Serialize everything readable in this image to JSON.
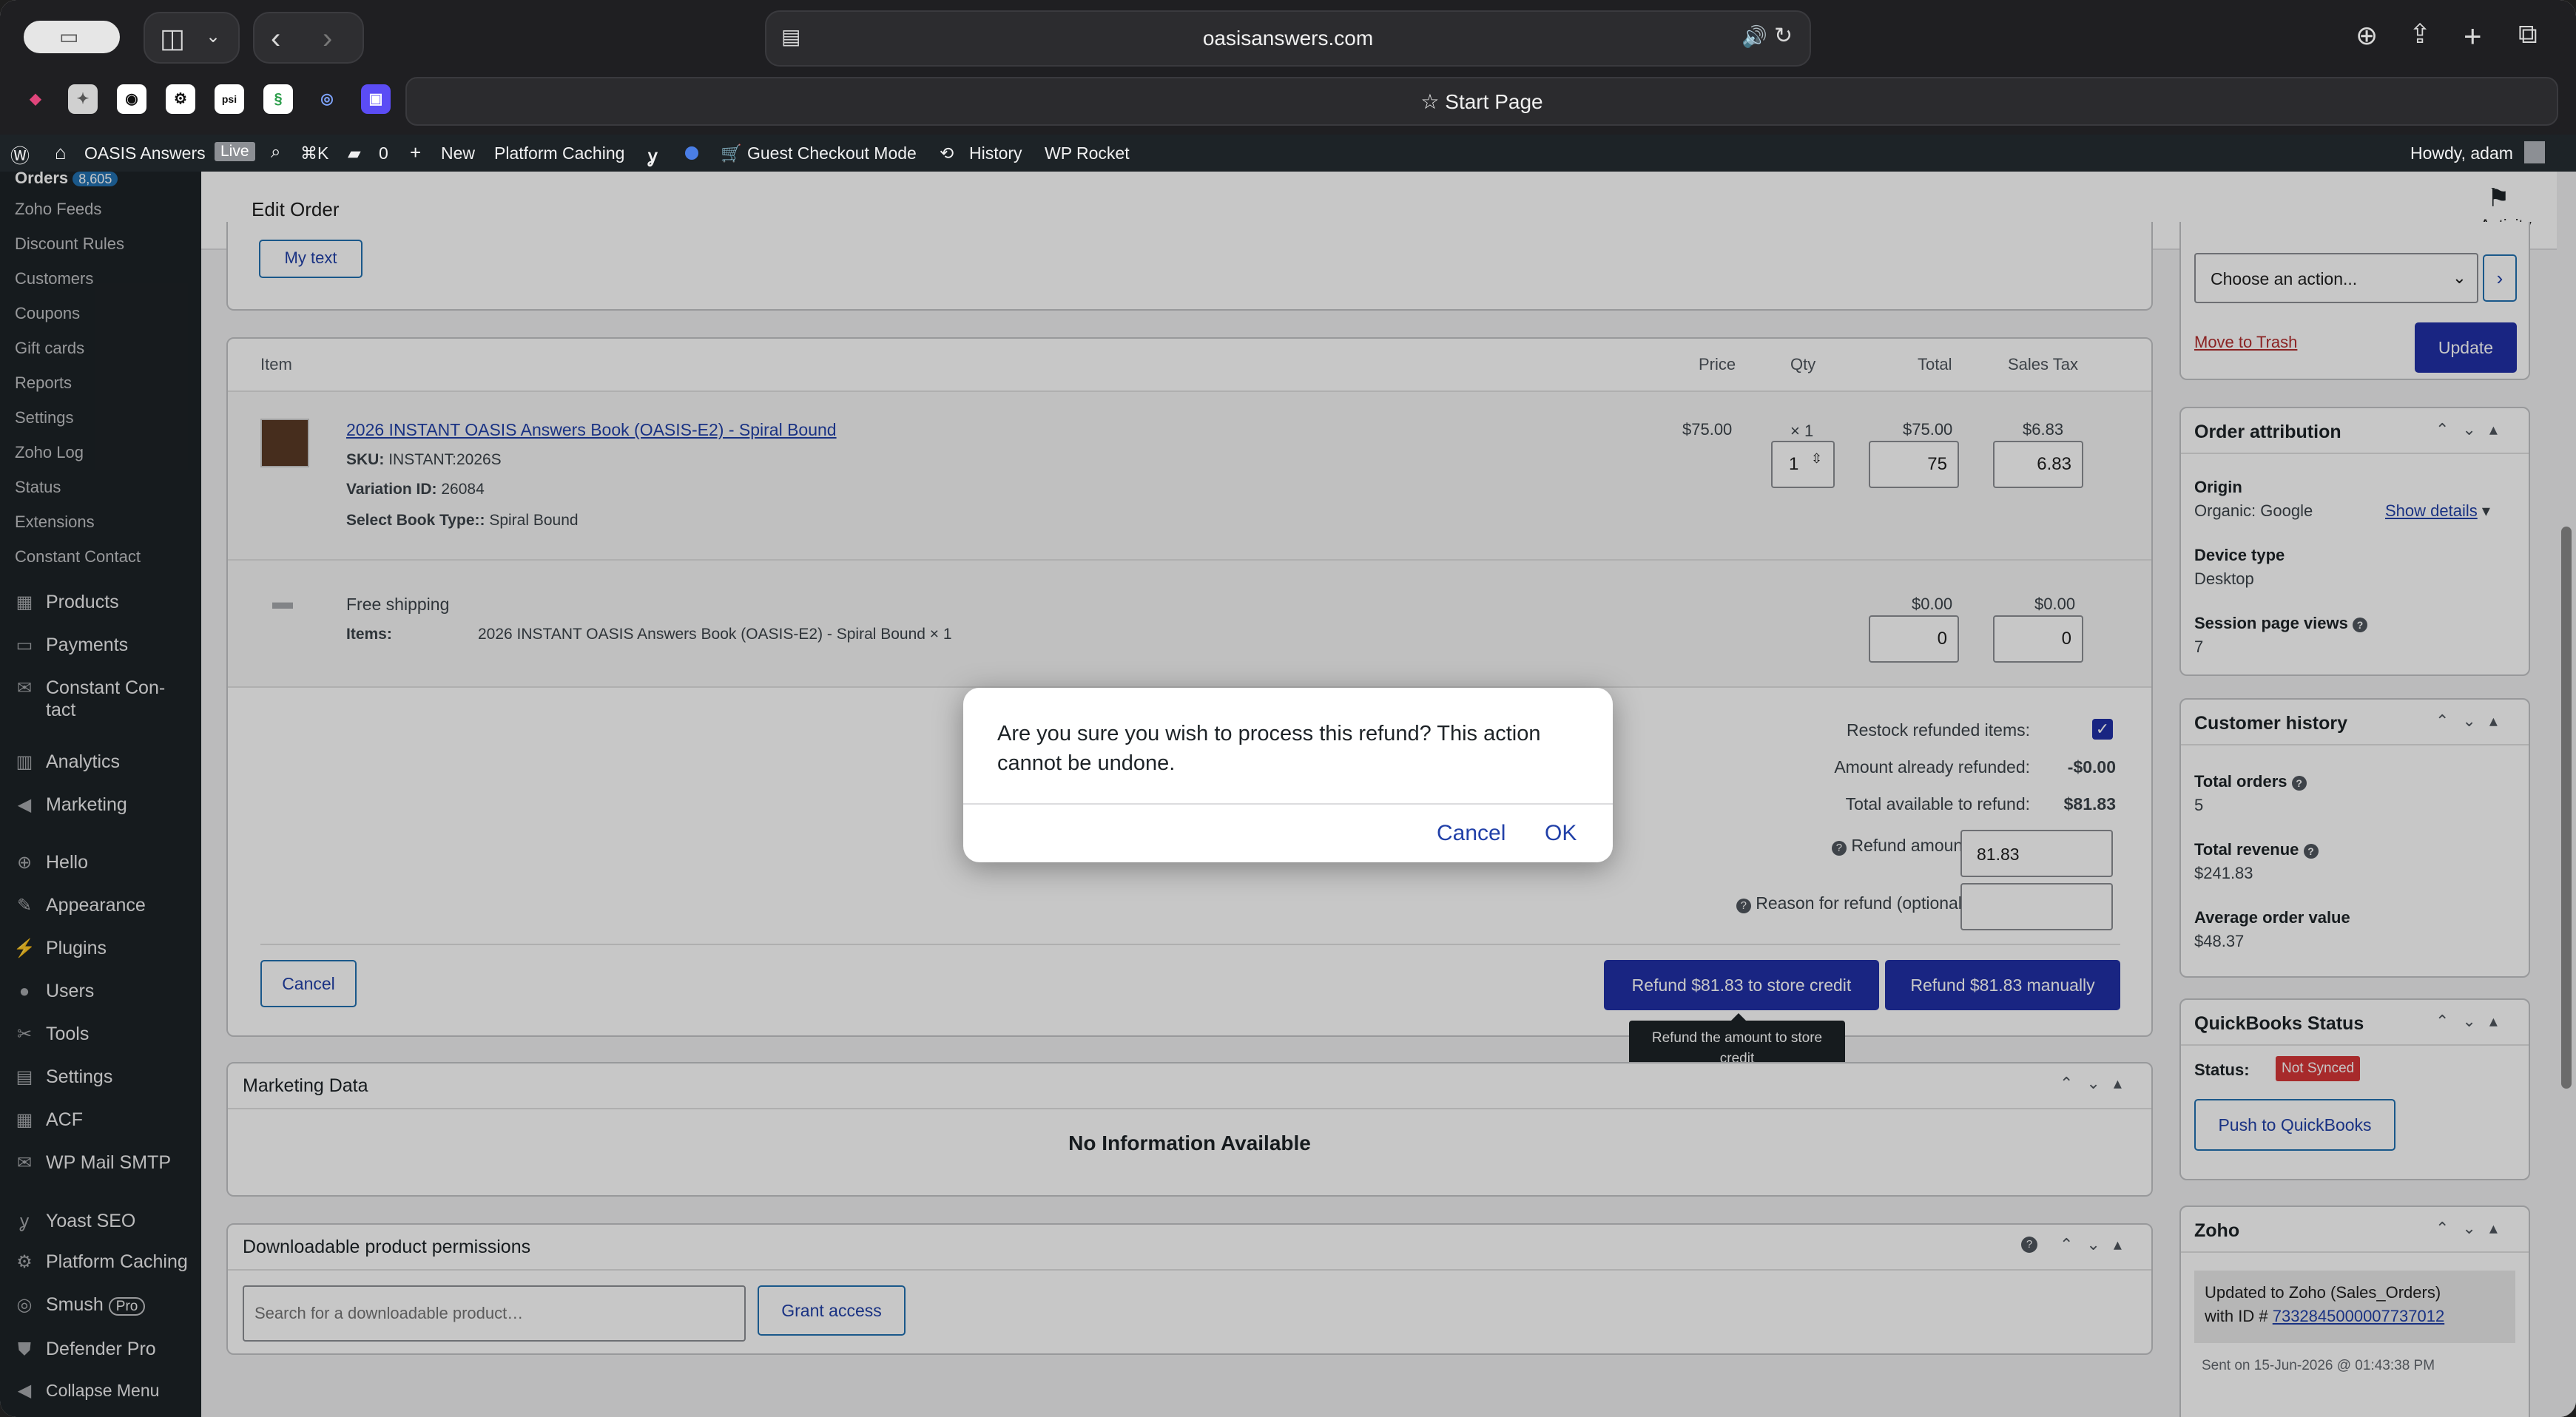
{
  "browser": {
    "url": "oasisanswers.com",
    "start_page": "Start Page"
  },
  "adminbar": {
    "site_name": "OASIS Answers",
    "live_badge": "Live",
    "search_shortcut": "⌘K",
    "comments_count": "0",
    "new": "New",
    "platform_caching": "Platform Caching",
    "guest_checkout": "Guest Checkout Mode",
    "history": "History",
    "wp_rocket": "WP Rocket",
    "howdy": "Howdy, adam"
  },
  "sidebar": {
    "orders": "Orders",
    "orders_count": "8,605",
    "subitems": [
      "Zoho Feeds",
      "Discount Rules",
      "Customers",
      "Coupons",
      "Gift cards",
      "Reports",
      "Settings",
      "Zoho Log",
      "Status",
      "Extensions",
      "Constant Contact"
    ],
    "menu": {
      "products": "Products",
      "payments": "Payments",
      "constant1": "Constant Con-",
      "constant2": "tact",
      "analytics": "Analytics",
      "marketing": "Marketing",
      "hello": "Hello",
      "appearance": "Appearance",
      "plugins": "Plugins",
      "users": "Users",
      "tools": "Tools",
      "settings": "Settings",
      "acf": "ACF",
      "wpmail": "WP Mail SMTP",
      "yoast": "Yoast SEO",
      "platform": "Platform Caching",
      "smush": "Smush",
      "smush_pro": "Pro",
      "defender": "Defender Pro",
      "collapse": "Collapse Menu"
    }
  },
  "header": {
    "title": "Edit Order",
    "activity": "Activity"
  },
  "top_box": {
    "my_text": "My text"
  },
  "items": {
    "headers": {
      "item": "Item",
      "price": "Price",
      "qty": "Qty",
      "total": "Total",
      "tax": "Sales Tax"
    },
    "product": {
      "name": "2026 INSTANT OASIS Answers Book (OASIS-E2) - Spiral Bound",
      "sku_label": "SKU:",
      "sku": "INSTANT:2026S",
      "variation_label": "Variation ID:",
      "variation": "26084",
      "booktype_label": "Select Book Type::",
      "booktype": "Spiral Bound",
      "price": "$75.00",
      "qty": "× 1",
      "qty_input": "1",
      "total": "$75.00",
      "total_input": "75",
      "tax": "$6.83",
      "tax_input": "6.83"
    },
    "shipping": {
      "name": "Free shipping",
      "items_label": "Items:",
      "items": "2026 INSTANT OASIS Answers Book (OASIS-E2) - Spiral Bound × 1",
      "total": "$0.00",
      "total_input": "0",
      "tax": "$0.00",
      "tax_input": "0"
    },
    "refund": {
      "restock_label": "Restock refunded items:",
      "already_label": "Amount already refunded:",
      "already": "-$0.00",
      "available_label": "Total available to refund:",
      "available": "$81.83",
      "amount_label": "Refund amount:",
      "amount": "81.83",
      "reason_label": "Reason for refund (optional):",
      "cancel": "Cancel",
      "store_credit": "Refund $81.83 to store credit",
      "manually": "Refund $81.83 manually",
      "tooltip1": "Refund the amount to store",
      "tooltip2": "credit"
    }
  },
  "marketing": {
    "title": "Marketing Data",
    "empty": "No Information Available"
  },
  "downloads": {
    "title": "Downloadable product permissions",
    "placeholder": "Search for a downloadable product…",
    "grant": "Grant access"
  },
  "right": {
    "action_select": "Choose an action...",
    "trash": "Move to Trash",
    "update": "Update",
    "attribution": {
      "title": "Order attribution",
      "origin_label": "Origin",
      "origin": "Organic: Google",
      "show_details": "Show details",
      "device_label": "Device type",
      "device": "Desktop",
      "views_label": "Session page views",
      "views": "7"
    },
    "history": {
      "title": "Customer history",
      "orders_label": "Total orders",
      "orders": "5",
      "revenue_label": "Total revenue",
      "revenue": "$241.83",
      "aov_label": "Average order value",
      "aov": "$48.37"
    },
    "qb": {
      "title": "QuickBooks Status",
      "status_label": "Status:",
      "status": "Not Synced",
      "push": "Push to QuickBooks"
    },
    "zoho": {
      "title": "Zoho",
      "note1": "Updated to Zoho (Sales_Orders)",
      "note2": "with ID #",
      "note_id": "7332845000007737012",
      "sent": "Sent on 15-Jun-2026 @ 01:43:38 PM"
    }
  },
  "dialog": {
    "message1": "Are you sure you wish to process this refund? This action",
    "message2": "cannot be undone.",
    "cancel": "Cancel",
    "ok": "OK"
  },
  "colors": {
    "primary": "#2130a7",
    "link": "#2140a8",
    "not_synced": "#d63638",
    "admin_dark": "#1d2327"
  }
}
